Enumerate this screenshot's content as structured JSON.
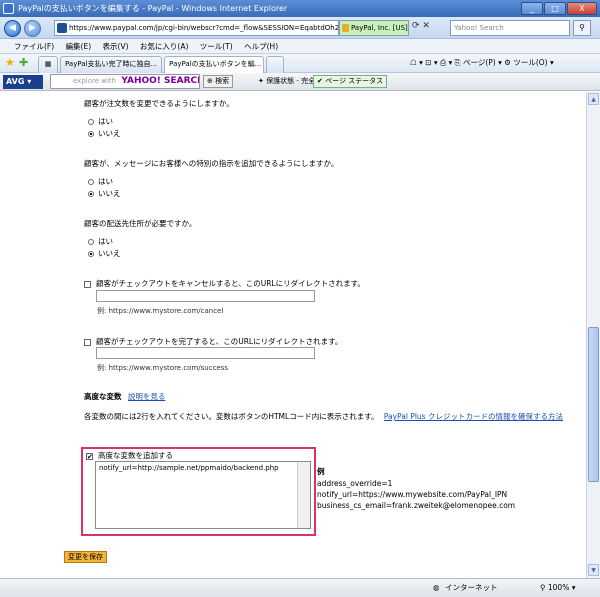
{
  "window": {
    "title": "PayPalの支払いボタンを編集する - PayPal - Windows Internet Explorer",
    "min": "_",
    "max": "□",
    "close": "X"
  },
  "address": {
    "url": "https://www.paypal.com/jp/cgi-bin/webscr?cmd=_flow&SESSION=EqabtdOh2KE80z",
    "secure": "PayPal, Inc. [US]",
    "search_placeholder": "Yahoo! Search",
    "go": "→"
  },
  "menu": [
    "ファイル(F)",
    "編集(E)",
    "表示(V)",
    "お気に入り(A)",
    "ツール(T)",
    "ヘルプ(H)"
  ],
  "tabs": [
    {
      "label": "PayPal支払い完了時に独自..."
    },
    {
      "label": "PayPalの支払いボタンを編..."
    }
  ],
  "commands": "☖ ▾ ⊡ ▾  ⎙ ▾ ⎘ ページ(P) ▾  ⚙ ツール(O) ▾",
  "avg": {
    "logo": "AVG ▾",
    "yahoo_prefix": "explore with",
    "yahoo_brand": "YAHOO! SEARCH",
    "search": "⊕ 検索",
    "status": "✦ 保護状態 - 完全",
    "page_status": "✔ ページ ステータス"
  },
  "form": {
    "q1": "顧客が注文数を変更できるようにしますか。",
    "q2": "顧客が、メッセージにお客様への特別の指示を追加できるようにしますか。",
    "q3": "顧客の配送先住所が必要ですか。",
    "yes": "はい",
    "no": "いいえ",
    "cancel_label": "顧客がチェックアウトをキャンセルすると、このURLにリダイレクトされます。",
    "cancel_hint": "例: https://www.mystore.com/cancel",
    "return_label": "顧客がチェックアウトを完了すると、このURLにリダイレクトされます。",
    "return_hint": "例: https://www.mystore.com/success",
    "adv_title": "高度な変数",
    "adv_link": "説明を見る",
    "adv_desc": "各変数の間には2行を入れてください。変数はボタンのHTMLコード内に表示されます。",
    "adv_desc_link": "PayPal Plus クレジットカードの情報を確保する方法",
    "adv_check_label": "高度な変数を追加する",
    "adv_value": "notify_url=http://sample.net/ppmaido/backend.php",
    "example_title": "例",
    "examples": [
      "address_override=1",
      "notify_url=https://www.mywebsite.com/PayPal_IPN",
      "business_cs_email=frank.zweitek@elomenopee.com"
    ],
    "save": "変更を保存"
  },
  "status": {
    "zone": "インターネット",
    "zoom": "100%"
  }
}
